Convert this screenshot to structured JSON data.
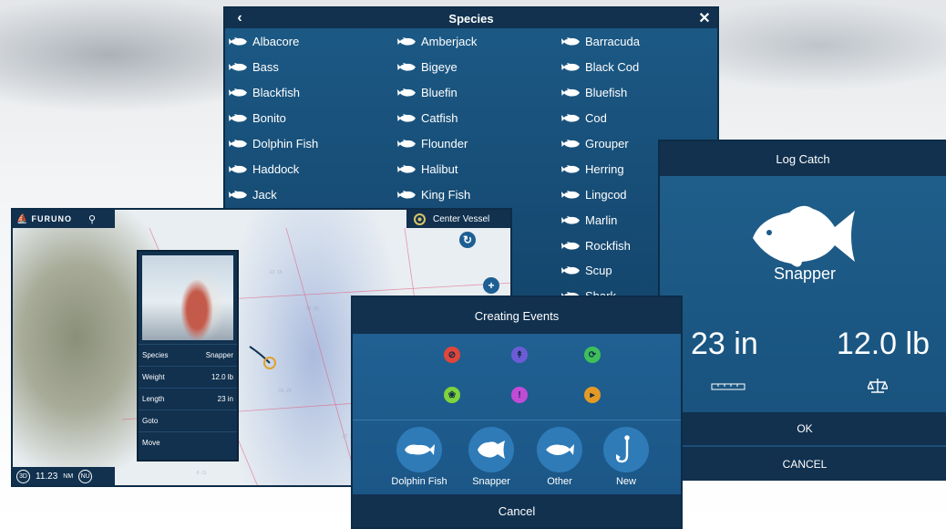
{
  "species_panel": {
    "title": "Species",
    "back_icon": "chevron-left-icon",
    "close_icon": "close-icon",
    "items": [
      "Albacore",
      "Amberjack",
      "Barracuda",
      "Bass",
      "Bigeye",
      "Black Cod",
      "Blackfish",
      "Bluefin",
      "Bluefish",
      "Bonito",
      "Catfish",
      "Cod",
      "Dolphin Fish",
      "Flounder",
      "Grouper",
      "Haddock",
      "Halibut",
      "Herring",
      "Jack",
      "King Fish",
      "Lingcod",
      "",
      "",
      "Marlin",
      "",
      "",
      "Rockfish",
      "",
      "",
      "Scup",
      "",
      "",
      "Shark"
    ]
  },
  "plotter": {
    "brand": "FURUNO",
    "center_vessel": "Center Vessel",
    "range_value": "11.23",
    "range_unit": "NM",
    "mode_3d": "3D",
    "mode_nu": "NU",
    "catch_card": {
      "rows": [
        {
          "label": "Species",
          "value": "Snapper"
        },
        {
          "label": "Weight",
          "value": "12.0 lb"
        },
        {
          "label": "Length",
          "value": "23 in"
        },
        {
          "label": "Goto",
          "value": ""
        },
        {
          "label": "Move",
          "value": ""
        }
      ]
    }
  },
  "log_catch": {
    "title": "Log Catch",
    "species": "Snapper",
    "length": "23 in",
    "weight": "12.0 lb",
    "ok": "OK",
    "cancel": "CANCEL"
  },
  "creating_events": {
    "title": "Creating Events",
    "event_icon_colors": [
      "#e0463a",
      "#6b5cd6",
      "#3fbf5a",
      "#7fd33c",
      "#c24bd6",
      "#e39a24"
    ],
    "buttons": [
      {
        "label": "Dolphin Fish",
        "icon": "dolphin-fish-icon"
      },
      {
        "label": "Snapper",
        "icon": "snapper-icon"
      },
      {
        "label": "Other",
        "icon": "fish-icon"
      },
      {
        "label": "New",
        "icon": "hook-icon"
      }
    ],
    "cancel": "Cancel"
  }
}
